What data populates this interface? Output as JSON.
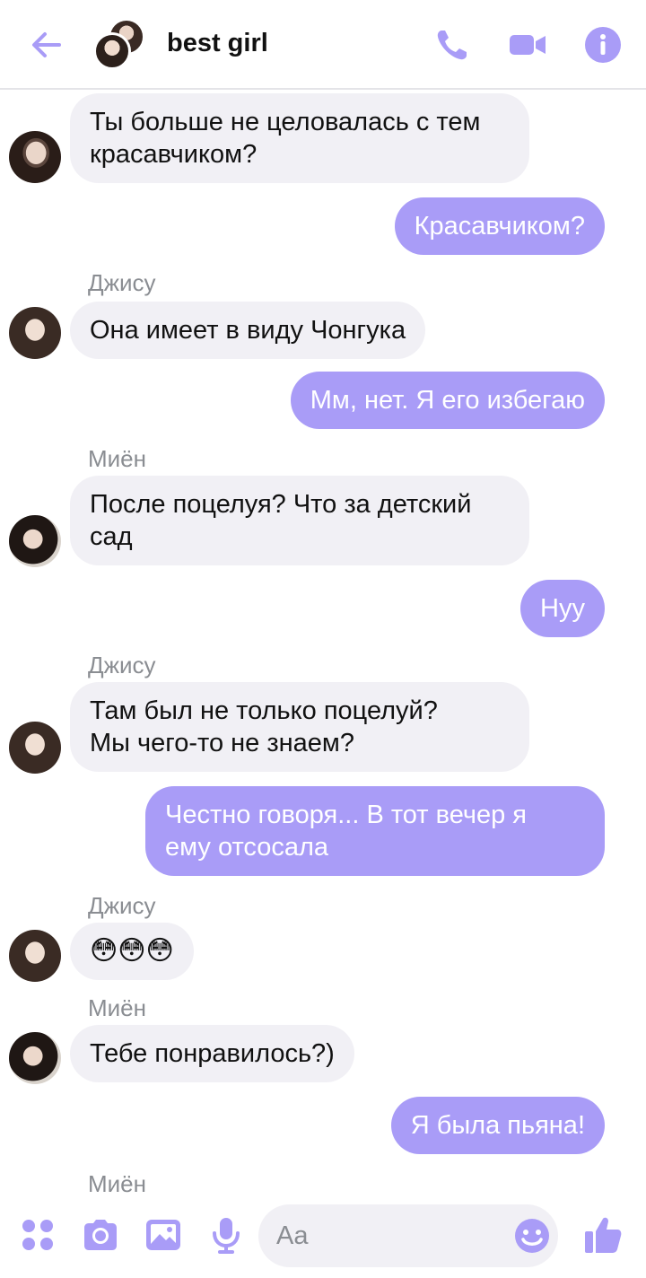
{
  "header": {
    "title": "best girl"
  },
  "colors": {
    "accent": "#a99cf7",
    "incoming_bubble": "#f1f0f5",
    "sender_name": "#8a8d92"
  },
  "messages": [
    {
      "text_lines": [
        "Ты больше не целовалась с тем",
        "красавчиком?"
      ]
    },
    {
      "text_lines": [
        "Красавчиком?"
      ]
    },
    {
      "sender": "Джису",
      "text_lines": [
        "Она имеет в виду Чонгука"
      ]
    },
    {
      "text_lines": [
        "Мм, нет. Я его избегаю"
      ]
    },
    {
      "sender": "Миён",
      "text_lines": [
        "После поцелуя? Что за детский",
        "сад"
      ]
    },
    {
      "text_lines": [
        "Нуу"
      ]
    },
    {
      "sender": "Джису",
      "text_lines": [
        "Там был не только поцелуй?",
        "Мы чего-то не знаем?"
      ]
    },
    {
      "text_lines": [
        "Честно говоря... В тот вечер я",
        "ему отсосала"
      ]
    },
    {
      "sender": "Джису",
      "text_lines": [
        "😳😳😳"
      ]
    },
    {
      "sender": "Миён",
      "text_lines": [
        "Тебе понравилось?)"
      ]
    },
    {
      "text_lines": [
        "Я была пьяна!"
      ]
    },
    {
      "sender": "Миён"
    }
  ],
  "composer": {
    "placeholder": "Aa"
  },
  "icons": {
    "back": "back-arrow-icon",
    "call": "phone-icon",
    "video": "video-camera-icon",
    "info": "info-icon",
    "menu": "four-dots-icon",
    "camera": "camera-icon",
    "gallery": "image-icon",
    "mic": "microphone-icon",
    "emoji": "smiley-icon",
    "like": "thumbs-up-icon"
  }
}
